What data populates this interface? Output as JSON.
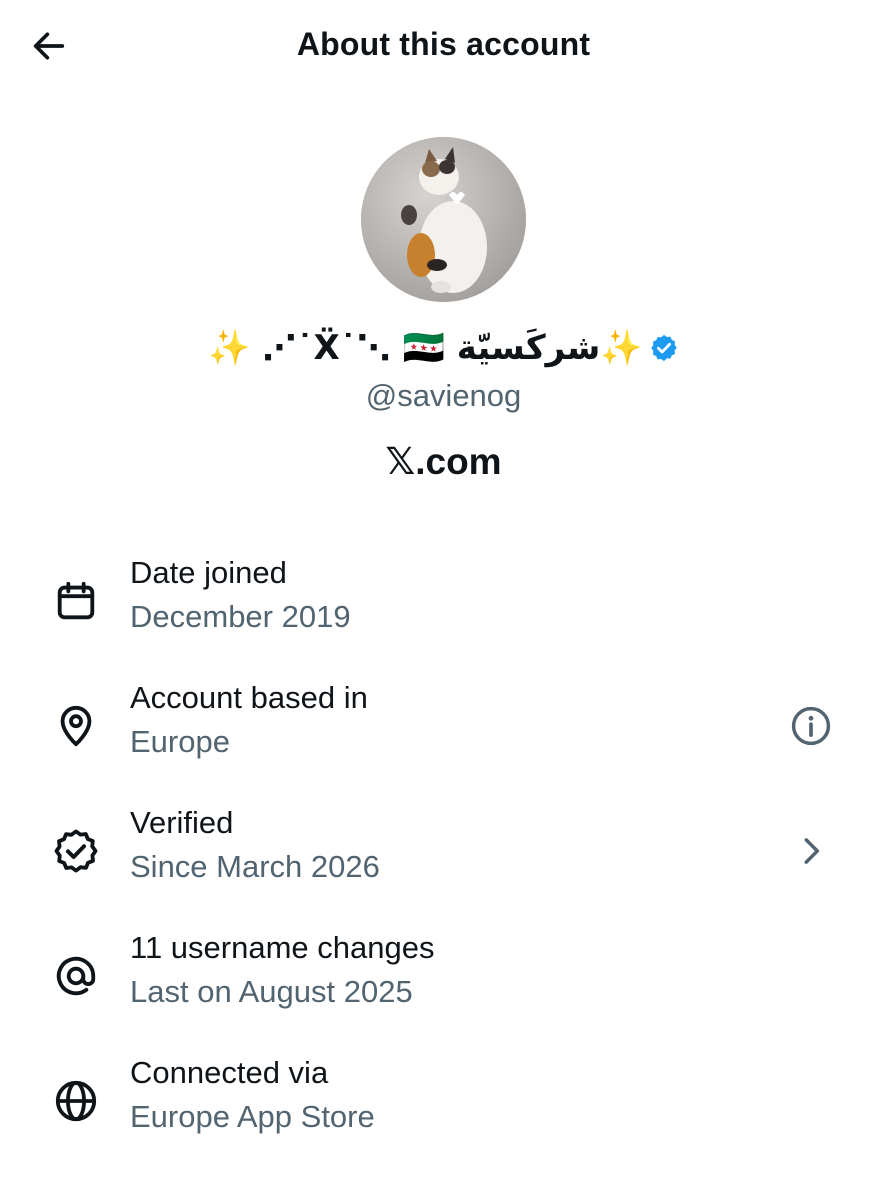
{
  "header": {
    "title": "About this account",
    "back_icon": "back-arrow-icon"
  },
  "profile": {
    "display_name": "✨ ⋰˙Ẍ˙⋱ 🇸🇾 شركَسيّة✨",
    "verified_badge_icon": "verified-badge-icon",
    "verified_color": "#1d9bf0",
    "handle": "@savienog",
    "site_logo_text": "𝕏",
    "site_suffix": ".com"
  },
  "details": [
    {
      "icon": "calendar-icon",
      "label": "Date joined",
      "value": "December 2019"
    },
    {
      "icon": "location-pin-icon",
      "label": "Account based in",
      "value": "Europe",
      "trailing_icon": "info-icon"
    },
    {
      "icon": "verified-outline-icon",
      "label": "Verified",
      "value": "Since March 2026",
      "trailing_icon": "chevron-right-icon"
    },
    {
      "icon": "at-sign-icon",
      "label": "11 username changes",
      "value": "Last on August 2025"
    },
    {
      "icon": "globe-icon",
      "label": "Connected via",
      "value": "Europe App Store"
    }
  ],
  "colors": {
    "primary_text": "#0f1419",
    "secondary_text": "#536471"
  }
}
